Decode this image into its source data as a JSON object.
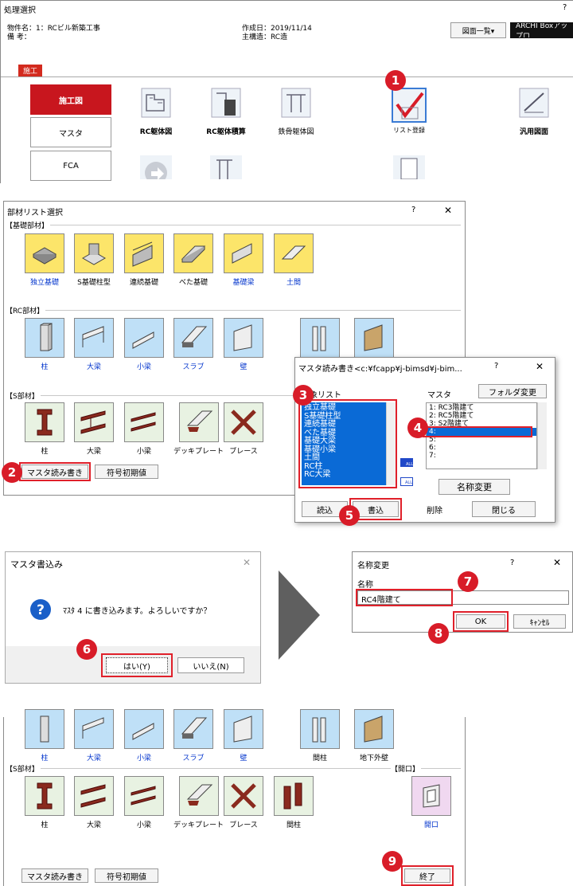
{
  "top": {
    "title": "処理選択",
    "help": "?",
    "info1": "物件名：1：RCビル新築工事",
    "info2": "備 考：",
    "info3": "作成日：2019/11/14",
    "info4": "主構造：RC造",
    "list_btn": "図面一覧▾",
    "archi_btn": "ARCHI Boxアップロ",
    "tab": "施工",
    "side": [
      "施工図",
      "マスタ",
      "FCA"
    ],
    "icons": [
      "RC躯体図",
      "RC躯体積算",
      "鉄骨躯体図",
      "リスト登録",
      "汎用図面"
    ],
    "badge": "1"
  },
  "buzai": {
    "title": "部材リスト選択",
    "help": "?",
    "close": "✕",
    "g1": "【基礎部材】",
    "g1_items": [
      "独立基礎",
      "S基礎柱型",
      "連続基礎",
      "べた基礎",
      "基礎梁",
      "土間"
    ],
    "g2": "【RC部材】",
    "g2_items": [
      "柱",
      "大梁",
      "小梁",
      "スラブ",
      "壁"
    ],
    "g3": "【S部材】",
    "g3_items": [
      "柱",
      "大梁",
      "小梁",
      "デッキプレート",
      "ブレース"
    ],
    "master_btn": "マスタ読み書き",
    "init_btn": "符号初期値",
    "badge": "2"
  },
  "rw": {
    "title": "マスタ読み書き<c:¥fcapp¥j-bimsd¥j-bim...",
    "help": "?",
    "close": "✕",
    "target_label": "対象リスト",
    "master_label": "マスタ",
    "folder_btn": "フォルダ変更",
    "targets": [
      "独立基礎",
      "S基礎柱型",
      "連続基礎",
      "べた基礎",
      "基礎大梁",
      "基礎小梁",
      "土間",
      "RC柱",
      "RC大梁"
    ],
    "masters": [
      "1: RC3階建て",
      "2: RC5階建て",
      "3: S2階建て",
      "4:",
      "5:",
      "6:",
      "7:"
    ],
    "all1": "ALL",
    "all2": "ALL",
    "rename_btn": "名称変更",
    "read_btn": "読込",
    "write_btn": "書込",
    "delete_btn": "削除",
    "close_btn": "閉じる",
    "badge3": "3",
    "badge4": "4",
    "badge5": "5"
  },
  "confirm": {
    "title": "マスタ書込み",
    "close": "✕",
    "message": "ﾏｽﾀ 4 に書き込みます。よろしいですか？",
    "yes": "はい(Y)",
    "no": "いいえ(N)",
    "badge": "6"
  },
  "rename": {
    "title": "名称変更",
    "help": "?",
    "close": "✕",
    "label": "名称",
    "value": "RC4階建て",
    "ok": "OK",
    "cancel": "ｷｬﾝｾﾙ",
    "badge7": "7",
    "badge8": "8"
  },
  "bottom": {
    "row1": [
      "柱",
      "大梁",
      "小梁",
      "スラブ",
      "壁",
      "間柱",
      "地下外壁"
    ],
    "g3": "【S部材】",
    "g4": "【開口】",
    "row2": [
      "柱",
      "大梁",
      "小梁",
      "デッキプレート",
      "ブレース",
      "間柱"
    ],
    "kaikou": "開口",
    "master_btn": "マスタ読み書き",
    "init_btn": "符号初期値",
    "end_btn": "終了",
    "badge": "9"
  },
  "colors": {
    "accent": "#d81c28",
    "select": "#0a6ad6",
    "link": "#0033cc"
  }
}
